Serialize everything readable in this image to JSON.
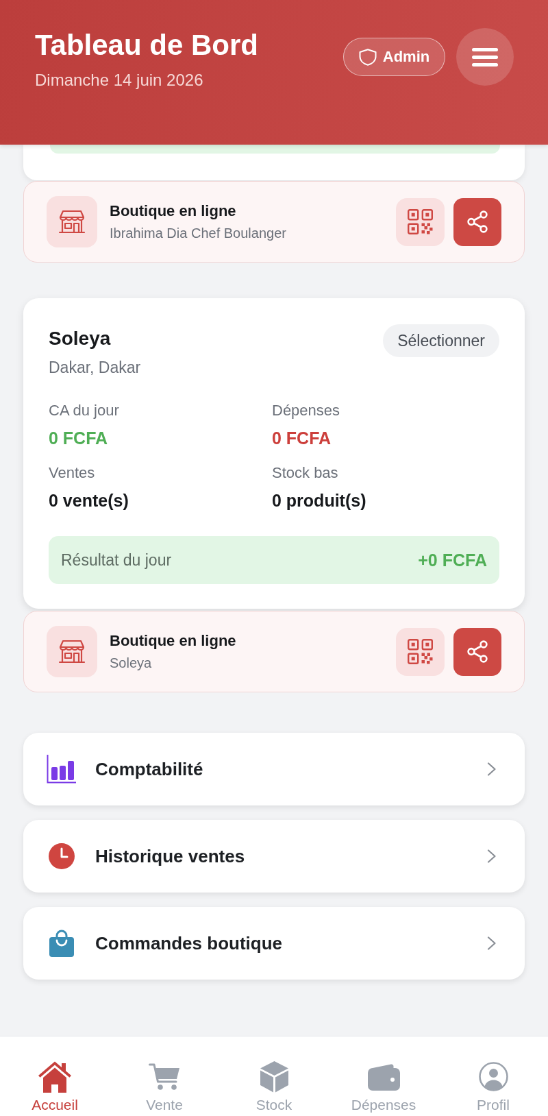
{
  "header": {
    "title": "Tableau de Bord",
    "date": "Dimanche 14 juin 2026",
    "role_badge": "Admin"
  },
  "shops": [
    {
      "cut_off": true,
      "online_shop": {
        "title": "Boutique en ligne",
        "name": "Ibrahima Dia Chef Boulanger"
      }
    },
    {
      "cut_off": false,
      "name": "Soleya",
      "location": "Dakar, Dakar",
      "select_label": "Sélectionner",
      "stats": [
        {
          "label": "CA du jour",
          "value": "0 FCFA",
          "color": "#4fae55"
        },
        {
          "label": "Dépenses",
          "value": "0 FCFA",
          "color": "#cc3f3b"
        },
        {
          "label": "Ventes",
          "value": "0 vente(s)",
          "color": "#17191c"
        },
        {
          "label": "Stock bas",
          "value": "0 produit(s)",
          "color": "#17191c"
        }
      ],
      "result": {
        "label": "Résultat du jour",
        "value": "+0 FCFA",
        "positive": true
      },
      "online_shop": {
        "title": "Boutique en ligne",
        "name": "Soleya"
      }
    }
  ],
  "menu": [
    {
      "label": "Comptabilité"
    },
    {
      "label": "Historique ventes"
    },
    {
      "label": "Commandes boutique"
    }
  ],
  "nav": [
    {
      "label": "Accueil",
      "selected": true
    },
    {
      "label": "Vente",
      "selected": false
    },
    {
      "label": "Stock",
      "selected": false
    },
    {
      "label": "Dépenses",
      "selected": false
    },
    {
      "label": "Profil",
      "selected": false
    }
  ]
}
